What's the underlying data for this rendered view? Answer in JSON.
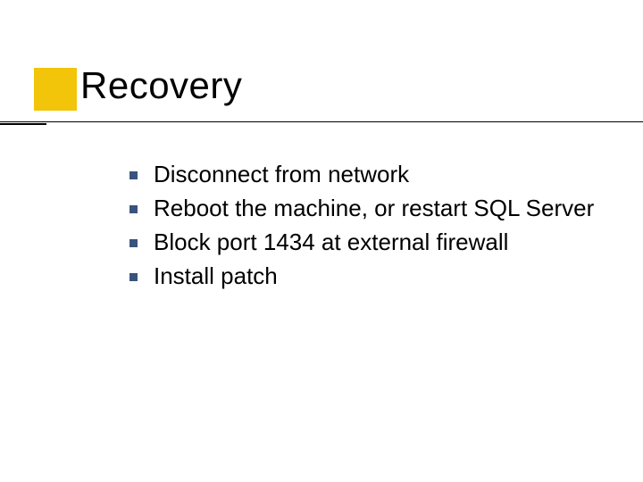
{
  "title": "Recovery",
  "bullets": [
    "Disconnect from network",
    "Reboot the machine, or restart SQL Server",
    "Block port 1434 at external firewall",
    "Install patch"
  ],
  "colors": {
    "accent_square": "#f2c40a",
    "bullet": "#3a537e"
  }
}
